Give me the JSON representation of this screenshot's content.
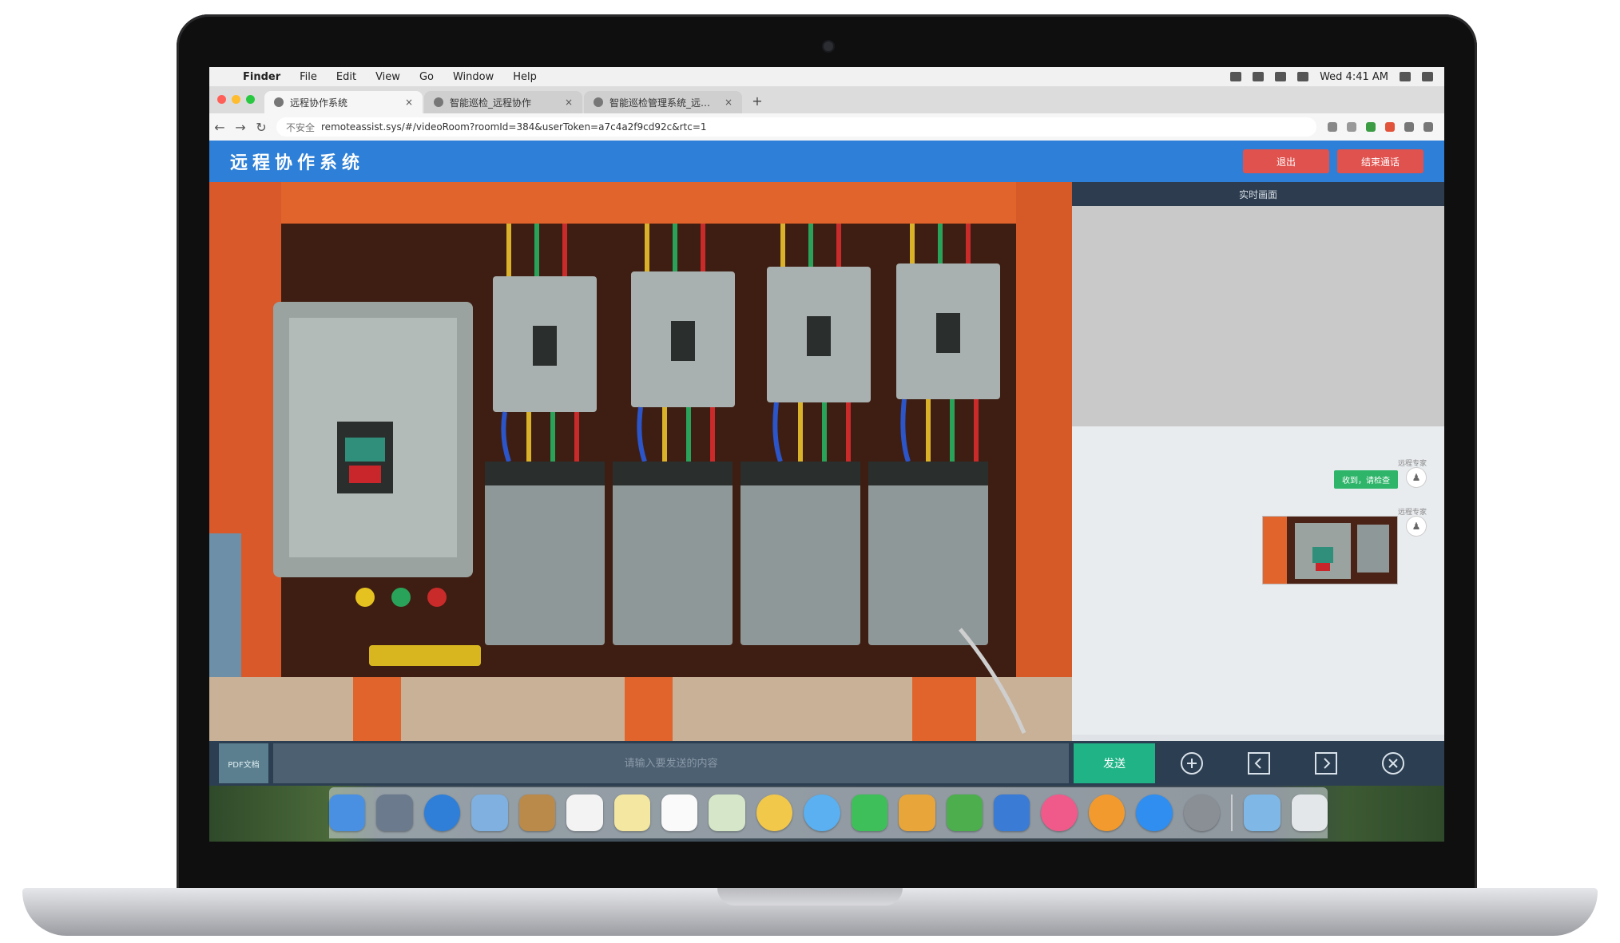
{
  "mac_menubar": {
    "items": [
      "Finder",
      "File",
      "Edit",
      "View",
      "Go",
      "Window",
      "Help"
    ],
    "time": "Wed 4:41 AM"
  },
  "browser": {
    "tabs": [
      {
        "label": "远程协作系统",
        "active": true
      },
      {
        "label": "智能巡检_远程协作",
        "active": false
      },
      {
        "label": "智能巡检管理系统_远程协作",
        "active": false
      }
    ],
    "new_tab_symbol": "+",
    "url_security": "不安全",
    "url": "remoteassist.sys/#/videoRoom?roomId=384&userToken=a7c4a2f9cd92c&rtc=1"
  },
  "app": {
    "title": "远程协作系统",
    "header_buttons": [
      "退出",
      "结束通话"
    ],
    "side_panel_title": "实时画面",
    "chat": [
      {
        "meta": "远程专家",
        "text": "收到，请检查",
        "type": "text"
      },
      {
        "meta": "远程专家",
        "type": "image"
      }
    ],
    "bottom_bar": {
      "file_button": "PDF文档",
      "input_placeholder": "请输入要发送的内容",
      "send_label": "发送"
    }
  },
  "colors": {
    "header_blue": "#2d7fd7",
    "header_button_red": "#e0524e",
    "send_green": "#1fb386",
    "bottom_bar": "#2c3e51",
    "panel_head": "#2d3d4f",
    "enclosure_orange": "#e0642c"
  },
  "icons": {
    "controls": [
      "zoom-in-icon",
      "prev-icon",
      "next-icon",
      "close-icon"
    ],
    "dock": [
      "finder-icon",
      "launchpad-icon",
      "safari-icon",
      "mail-icon",
      "contacts-icon",
      "calendar-icon",
      "notes-icon",
      "reminders-icon",
      "maps-icon",
      "photos-icon",
      "messages-icon",
      "facetime-icon",
      "pages-icon",
      "numbers-icon",
      "keynote-icon",
      "itunes-icon",
      "ibooks-icon",
      "app-store-icon",
      "system-preferences-icon",
      "downloads-folder-icon",
      "trash-icon"
    ]
  }
}
